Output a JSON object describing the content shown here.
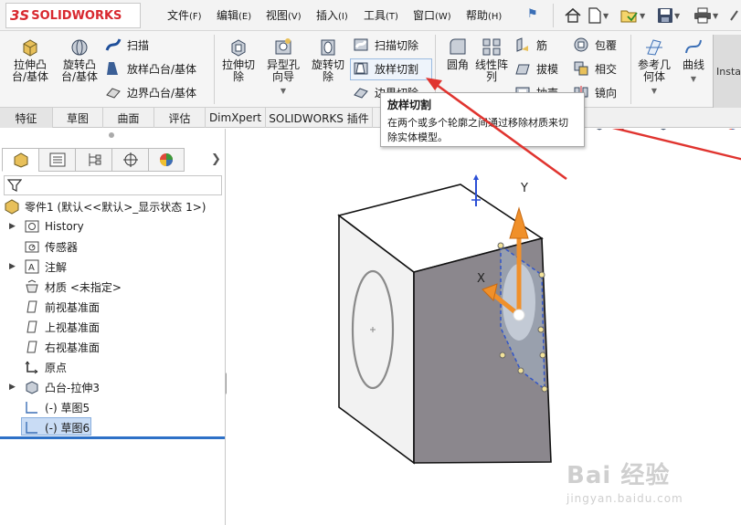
{
  "app": {
    "brand_ds": "3S",
    "brand_name": "SOLIDWORKS"
  },
  "menu": [
    {
      "label": "文件",
      "hotkey": "(F)"
    },
    {
      "label": "编辑",
      "hotkey": "(E)"
    },
    {
      "label": "视图",
      "hotkey": "(V)"
    },
    {
      "label": "插入",
      "hotkey": "(I)"
    },
    {
      "label": "工具",
      "hotkey": "(T)"
    },
    {
      "label": "窗口",
      "hotkey": "(W)"
    },
    {
      "label": "帮助",
      "hotkey": "(H)"
    }
  ],
  "quick_access": [
    "home-icon",
    "new-document-icon",
    "open-icon",
    "save-icon",
    "print-icon"
  ],
  "ribbon": {
    "extrude_boss": "拉伸凸\n台/基体",
    "revolve_boss": "旋转凸\n台/基体",
    "sweep": "扫描",
    "loft_boss": "放样凸台/基体",
    "boundary_boss": "边界凸台/基体",
    "extrude_cut": "拉伸切\n除",
    "hole_wizard": "异型孔\n向导",
    "revolve_cut": "旋转切\n除",
    "sweep_cut": "扫描切除",
    "loft_cut": "放样切割",
    "boundary_cut": "边界切除",
    "fillet": "圆角",
    "linear_pattern": "线性阵\n列",
    "rib": "筋",
    "draft": "拔模",
    "shell": "抽壳",
    "wrap": "包覆",
    "intersect": "相交",
    "mirror": "镜向",
    "ref_geometry": "参考几\n何体",
    "curves": "曲线",
    "instant3d": "Insta"
  },
  "tabs": [
    {
      "label": "特征",
      "active": true
    },
    {
      "label": "草图",
      "active": false
    },
    {
      "label": "曲面",
      "active": false
    },
    {
      "label": "评估",
      "active": false
    },
    {
      "label": "DimXpert",
      "active": false
    },
    {
      "label": "SOLIDWORKS 插件",
      "active": false
    }
  ],
  "tooltip": {
    "title": "放样切割",
    "body": "在两个或多个轮廓之间通过移除材质来切除实体模型。"
  },
  "feature_tree": {
    "root": "零件1 (默认<<默认>_显示状态 1>)",
    "items": [
      {
        "label": "History",
        "icon": "history-icon",
        "expandable": true
      },
      {
        "label": "传感器",
        "icon": "sensor-icon",
        "expandable": false
      },
      {
        "label": "注解",
        "icon": "annotation-icon",
        "expandable": true
      },
      {
        "label": "材质 <未指定>",
        "icon": "material-icon",
        "expandable": false
      },
      {
        "label": "前视基准面",
        "icon": "plane-icon",
        "expandable": false
      },
      {
        "label": "上视基准面",
        "icon": "plane-icon",
        "expandable": false
      },
      {
        "label": "右视基准面",
        "icon": "plane-icon",
        "expandable": false
      },
      {
        "label": "原点",
        "icon": "origin-icon",
        "expandable": false
      },
      {
        "label": "凸台-拉伸3",
        "icon": "boss-extrude-icon",
        "expandable": true
      },
      {
        "label": "(-) 草图5",
        "icon": "sketch-icon",
        "expandable": false
      },
      {
        "label": "(-) 草图6",
        "icon": "sketch-icon",
        "expandable": false,
        "selected": true
      }
    ]
  },
  "viewport": {
    "triad_y": "Y",
    "triad_x": "X",
    "drag_arrow_color": "#f0902a",
    "face_color": "#8b878d",
    "side_color": "#f0f0f0"
  },
  "watermark": {
    "big": "Bai 经验",
    "small": "jingyan.baidu.com"
  },
  "colors": {
    "brand": "#d8282f",
    "accent": "#2e71c7",
    "selection": "#c9dcf5",
    "annotation_arrow": "#e0342f"
  }
}
